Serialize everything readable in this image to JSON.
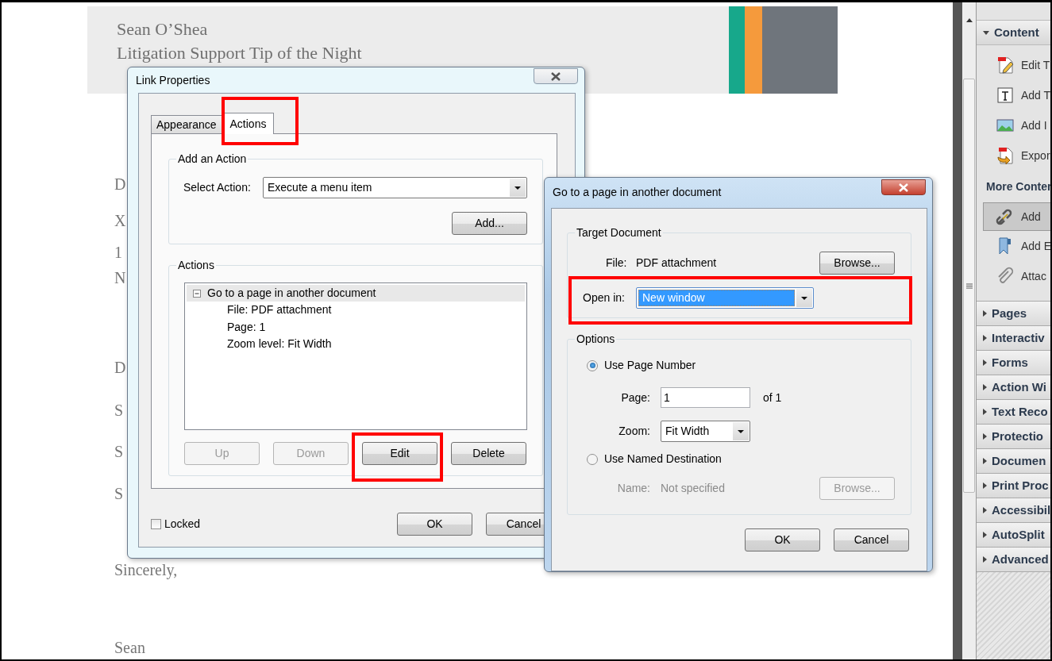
{
  "document": {
    "header": {
      "author": "Sean O’Shea",
      "subtitle": "Litigation Support Tip of the Night"
    },
    "lines": [
      "D",
      "X",
      "1",
      "N",
      "D",
      "S",
      "S",
      "S",
      "Sincerely,",
      "Sean"
    ]
  },
  "link_properties": {
    "title": "Link Properties",
    "tabs": [
      {
        "label": "Appearance",
        "selected": false,
        "annotated": false
      },
      {
        "label": "Actions",
        "selected": true,
        "annotated": true
      }
    ],
    "add_action": {
      "legend": "Add an Action",
      "select_label": "Select Action:",
      "select_value": "Execute a menu item",
      "add_button": "Add..."
    },
    "actions": {
      "legend": "Actions",
      "items": [
        {
          "label": "Go to a page in another document",
          "expanded": true,
          "selected": true,
          "children": [
            {
              "label": "File: PDF attachment"
            },
            {
              "label": "Page: 1"
            },
            {
              "label": "Zoom level: Fit Width"
            }
          ]
        }
      ],
      "buttons": [
        {
          "label": "Up",
          "disabled": true,
          "annotated": false
        },
        {
          "label": "Down",
          "disabled": true,
          "annotated": false
        },
        {
          "label": "Edit",
          "disabled": false,
          "annotated": true
        },
        {
          "label": "Delete",
          "disabled": false,
          "annotated": false
        }
      ]
    },
    "locked": {
      "label": "Locked",
      "checked": false
    },
    "footer_buttons": [
      "OK",
      "Cancel"
    ]
  },
  "goto_dialog": {
    "title": "Go to a page in another document",
    "target": {
      "legend": "Target Document",
      "file_label": "File:",
      "file_value": "PDF attachment",
      "browse": "Browse...",
      "open_label": "Open in:",
      "open_value": "New window",
      "annotated": true
    },
    "options": {
      "legend": "Options",
      "choices": [
        {
          "label": "Use Page Number",
          "selected": true
        },
        {
          "label": "Use Named Destination",
          "selected": false
        }
      ],
      "page_label": "Page:",
      "page_value": "1",
      "page_of": "of 1",
      "zoom_label": "Zoom:",
      "zoom_value": "Fit Width",
      "name_label": "Name:",
      "name_value": "Not specified",
      "name_browse": "Browse...",
      "name_disabled": true
    },
    "buttons": [
      "OK",
      "Cancel"
    ]
  },
  "panel": {
    "content": {
      "label": "Content",
      "expanded": true,
      "tools": [
        {
          "label": "Edit T",
          "kind": "edit"
        },
        {
          "label": "Add T",
          "kind": "text"
        },
        {
          "label": "Add I",
          "kind": "image"
        },
        {
          "label": "Expor",
          "kind": "export"
        }
      ],
      "more_label": "More Conter",
      "more_tools": [
        {
          "label": "Add",
          "kind": "link",
          "selected": true
        },
        {
          "label": "Add E",
          "kind": "bookmark",
          "selected": false
        },
        {
          "label": "Attac",
          "kind": "clip",
          "selected": false
        }
      ]
    },
    "sections": [
      {
        "label": "Pages",
        "expanded": false
      },
      {
        "label": "Interactiv",
        "expanded": false
      },
      {
        "label": "Forms",
        "expanded": false
      },
      {
        "label": "Action Wi",
        "expanded": false
      },
      {
        "label": "Text Reco",
        "expanded": false
      },
      {
        "label": "Protectio",
        "expanded": false
      },
      {
        "label": "Documen",
        "expanded": false
      },
      {
        "label": "Print Proc",
        "expanded": false
      },
      {
        "label": "Accessibil",
        "expanded": false
      },
      {
        "label": "AutoSplit",
        "expanded": false
      },
      {
        "label": "Advanced",
        "expanded": false
      }
    ]
  }
}
